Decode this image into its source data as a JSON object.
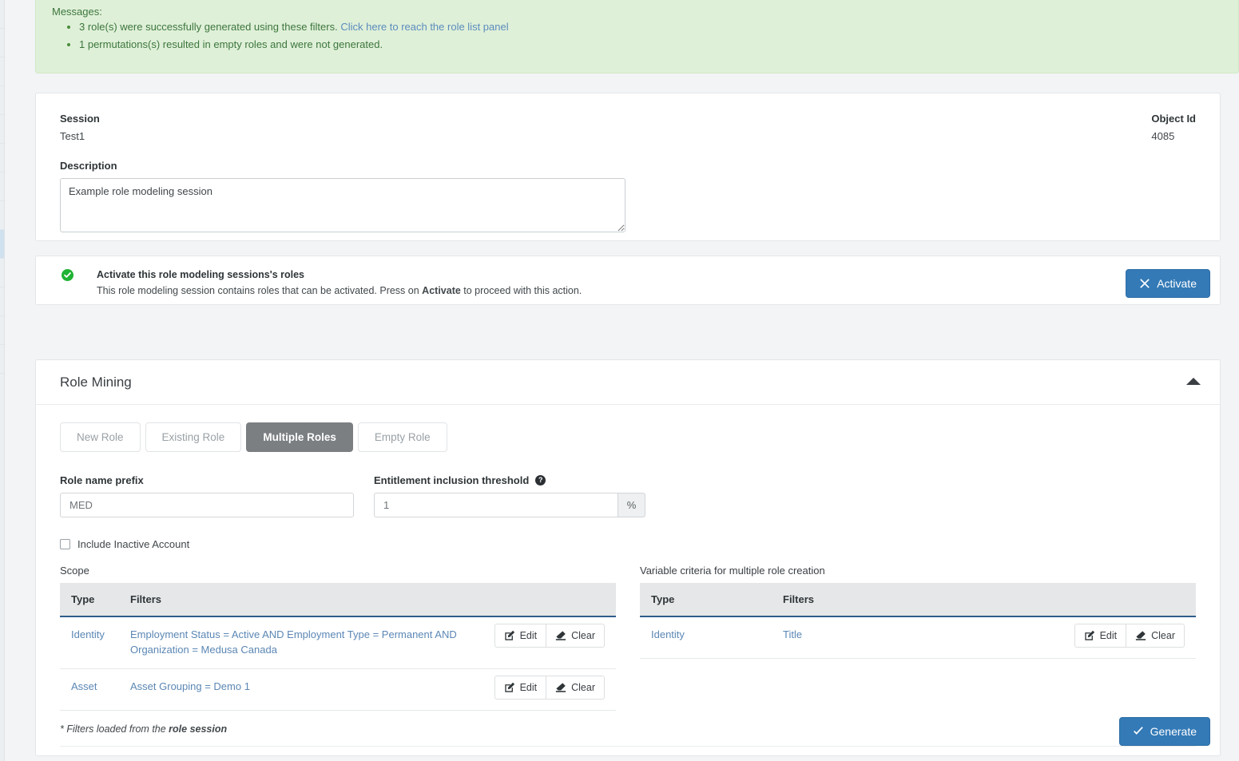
{
  "alert": {
    "title": "Messages:",
    "items": [
      {
        "text": "3 role(s) were successfully generated using these filters. ",
        "link": "Click here to reach the role list panel"
      },
      {
        "text": "1 permutations(s) resulted in empty roles and were not generated.",
        "link": ""
      }
    ]
  },
  "session": {
    "session_label": "Session",
    "session_value": "Test1",
    "object_id_label": "Object Id",
    "object_id_value": "4085",
    "description_label": "Description",
    "description_value": "Example role modeling session",
    "description_spellword": "role"
  },
  "activate": {
    "heading": "Activate this role modeling sessions's roles",
    "body_before": "This role modeling session contains roles that can be activated. Press on ",
    "body_bold": "Activate",
    "body_after": " to proceed with this action.",
    "button_label": "Activate",
    "icon": "check-circle-icon",
    "button_icon": "times-icon"
  },
  "mining": {
    "title": "Role Mining",
    "collapse_icon": "caret-up-icon",
    "tabs": [
      {
        "label": "New Role",
        "active": false
      },
      {
        "label": "Existing Role",
        "active": false
      },
      {
        "label": "Multiple Roles",
        "active": true
      },
      {
        "label": "Empty Role",
        "active": false
      }
    ],
    "prefix": {
      "label": "Role name prefix",
      "value": "MED",
      "placeholder": "MED"
    },
    "threshold": {
      "label": "Entitlement inclusion threshold",
      "help_icon": "question-circle-icon",
      "help_glyph": "?",
      "value": "1",
      "placeholder": "1",
      "addon": "%"
    },
    "inactive_checkbox": {
      "label": "Include Inactive Account",
      "checked": false
    },
    "scope": {
      "caption": "Scope",
      "columns": [
        "Type",
        "Filters"
      ],
      "rows": [
        {
          "type": "Identity",
          "filters": "Employment Status = Active AND Employment Type = Permanent AND Organization = Medusa Canada",
          "edit_label": "Edit",
          "clear_label": "Clear"
        },
        {
          "type": "Asset",
          "filters": "Asset Grouping = Demo 1",
          "edit_label": "Edit",
          "clear_label": "Clear"
        }
      ]
    },
    "variable": {
      "caption": "Variable criteria for multiple role creation",
      "columns": [
        "Type",
        "Filters"
      ],
      "rows": [
        {
          "type": "Identity",
          "filters": "Title",
          "edit_label": "Edit",
          "clear_label": "Clear"
        }
      ]
    },
    "footnote_before": "* Filters loaded from the ",
    "footnote_bold": "role session",
    "generate_label": "Generate",
    "generate_icon": "check-icon"
  },
  "colors": {
    "alert_bg": "#dff0d8",
    "alert_text": "#3c763d",
    "primary": "#337ab7",
    "link": "#5b87b5",
    "tab_active_bg": "#7b7f82",
    "table_header_bg": "#e6e7e8",
    "table_header_rule": "#2f5d8c",
    "success_icon": "#1fb233"
  }
}
